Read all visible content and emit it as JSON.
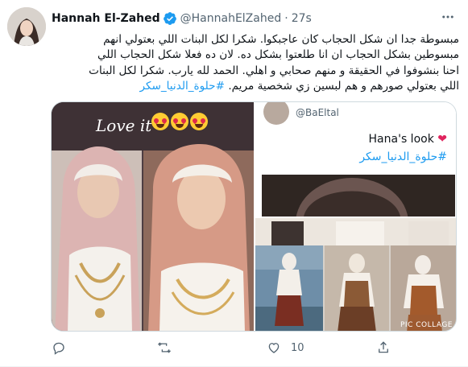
{
  "tweet": {
    "author_name": "Hannah El-Zahed",
    "handle": "@HannahElZahed",
    "separator": "·",
    "time": "27s",
    "text_lines": [
      "مبسوطة جدا ان شكل الحجاب كان عاجبكوا. شكرا لكل البنات اللي بعتولي انهم",
      "مبسوطين بشكل الحجاب ان انا طلعتوا بشكل ده. لان ده فعلا شكل الحجاب اللي",
      "احنا بنشوفوا في الحقيقة و منهم صحابي و اهلي. الحمد لله يارب. شكرا لكل البنات",
      "اللي بعتولي صورهم و هم لبسين زي شخصية مريم."
    ],
    "hashtag": "#حلوة_الدنيا_سكر"
  },
  "media": {
    "left_caption": "Love it",
    "quoted_handle": "@BaEltal",
    "quoted_text": "Hana's look",
    "quoted_hashtag": "#حلوة_الدنيا_سكر",
    "collage_label": "PIC COLLAGE"
  },
  "actions": {
    "reply_count": "",
    "retweet_count": "",
    "like_count": "10",
    "share_count": ""
  },
  "colors": {
    "accent": "#1d9bf0",
    "muted": "#536471",
    "verified": "#1d9bf0"
  }
}
